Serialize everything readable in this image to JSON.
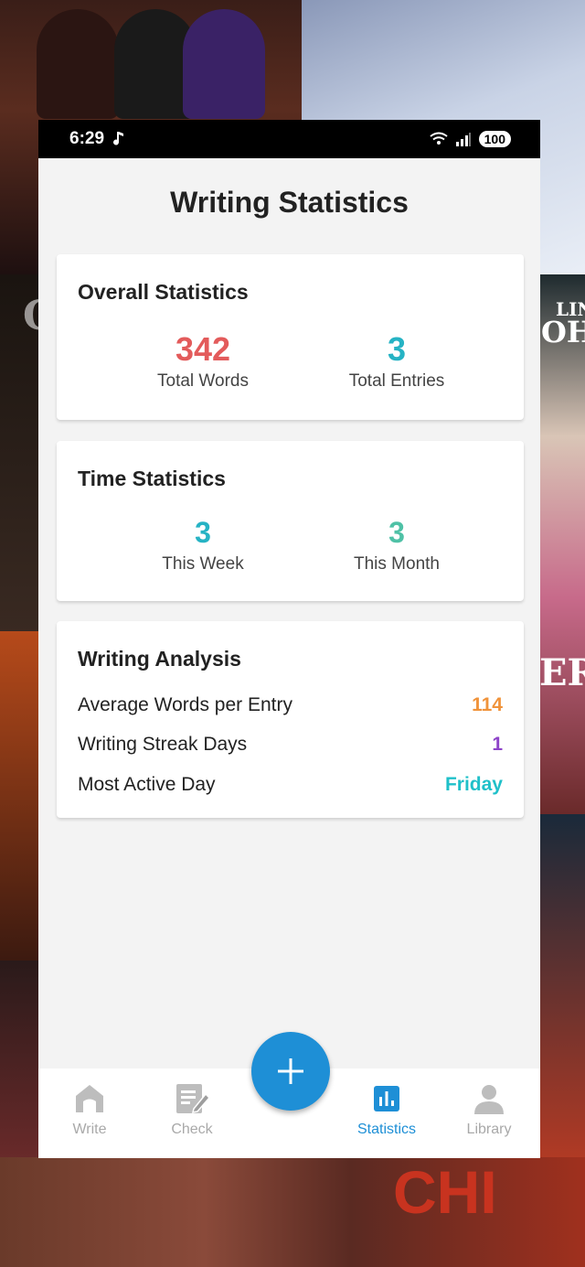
{
  "status_bar": {
    "time": "6:29",
    "battery": "100"
  },
  "header": {
    "title": "Writing Statistics"
  },
  "overall": {
    "title": "Overall Statistics",
    "total_words": "342",
    "total_words_label": "Total Words",
    "total_entries": "3",
    "total_entries_label": "Total Entries"
  },
  "time": {
    "title": "Time Statistics",
    "this_week": "3",
    "this_week_label": "This Week",
    "this_month": "3",
    "this_month_label": "This Month"
  },
  "analysis": {
    "title": "Writing Analysis",
    "rows": [
      {
        "label": "Average Words per Entry",
        "value": "114"
      },
      {
        "label": "Writing Streak Days",
        "value": "1"
      },
      {
        "label": "Most Active Day",
        "value": "Friday"
      }
    ]
  },
  "nav": {
    "items": [
      {
        "label": "Write",
        "icon": "home-icon"
      },
      {
        "label": "Check",
        "icon": "edit-note-icon"
      },
      {
        "label": "Statistics",
        "icon": "bar-chart-icon"
      },
      {
        "label": "Library",
        "icon": "person-icon"
      }
    ],
    "fab_icon": "plus-icon"
  },
  "background": {
    "text_right_1": "LIN",
    "text_right_2": "OH",
    "text_right_3": "ER",
    "text_left": "C",
    "text_bottom": "CHI"
  },
  "colors": {
    "accent": "#1e8fd6",
    "total_words": "#e35b5b",
    "teal": "#26b3c4",
    "teal_light": "#4fc1a6",
    "orange": "#f0933b",
    "purple": "#8e44c9",
    "friday": "#1fc0c9"
  }
}
